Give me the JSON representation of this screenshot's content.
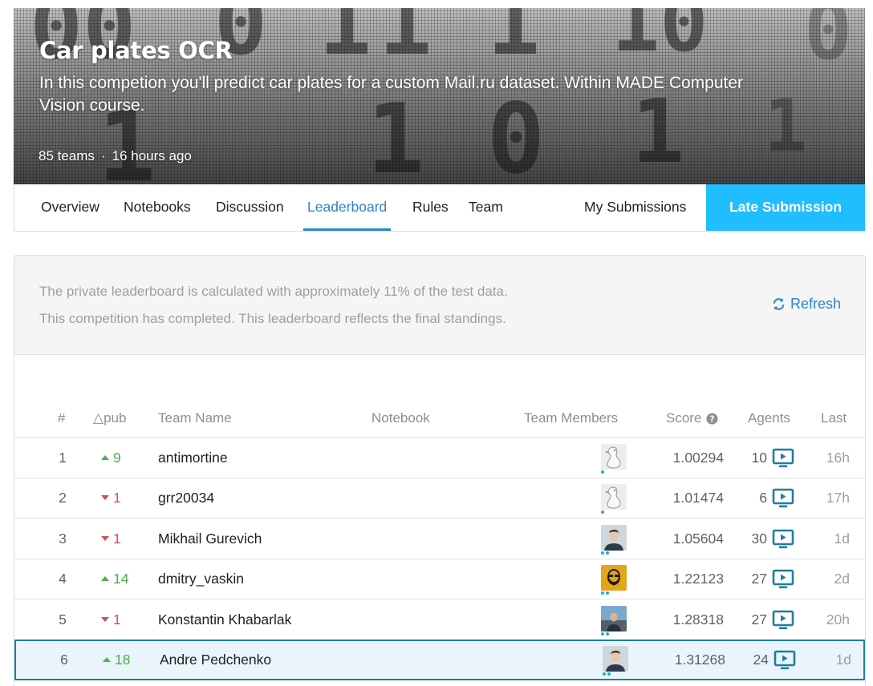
{
  "competition": {
    "title": "Car plates OCR",
    "subtitle": "In this competion you'll predict car plates for a custom Mail.ru dataset. Within MADE Computer Vision course.",
    "teams": "85 teams",
    "separator": "·",
    "updated": "16 hours ago"
  },
  "banner_digits": [
    "00",
    "0",
    "1",
    "1",
    "1",
    "10",
    "0",
    "1",
    "1",
    "0",
    "1",
    "1"
  ],
  "tabs": {
    "overview": "Overview",
    "notebooks": "Notebooks",
    "discussion": "Discussion",
    "leaderboard": "Leaderboard",
    "rules": "Rules",
    "team": "Team",
    "my_submissions": "My Submissions",
    "late_submission": "Late Submission"
  },
  "notice": {
    "line1": "The private leaderboard is calculated with approximately 11% of the test data.",
    "line2": "This competition has completed. This leaderboard reflects the final standings.",
    "refresh": "Refresh"
  },
  "columns": {
    "rank": "#",
    "delta": "△pub",
    "team_name": "Team Name",
    "notebook": "Notebook",
    "team_members": "Team Members",
    "score": "Score",
    "agents": "Agents",
    "last": "Last"
  },
  "rows": [
    {
      "rank": "1",
      "dir": "up",
      "delta": "9",
      "name": "antimortine",
      "avatar": "goose",
      "tiers": 1,
      "score": "1.00294",
      "agents": "10",
      "last": "16h"
    },
    {
      "rank": "2",
      "dir": "down",
      "delta": "1",
      "name": "grr20034",
      "avatar": "goose",
      "tiers": 1,
      "score": "1.01474",
      "agents": "6",
      "last": "17h"
    },
    {
      "rank": "3",
      "dir": "down",
      "delta": "1",
      "name": "Mikhail Gurevich",
      "avatar": "portrait",
      "tiers": 2,
      "score": "1.05604",
      "agents": "30",
      "last": "1d"
    },
    {
      "rank": "4",
      "dir": "up",
      "delta": "14",
      "name": "dmitry_vaskin",
      "avatar": "yellow-portrait",
      "tiers": 2,
      "score": "1.22123",
      "agents": "27",
      "last": "2d"
    },
    {
      "rank": "5",
      "dir": "down",
      "delta": "1",
      "name": "Konstantin Khabarlak",
      "avatar": "outdoor",
      "tiers": 2,
      "score": "1.28318",
      "agents": "27",
      "last": "20h"
    },
    {
      "rank": "6",
      "dir": "up",
      "delta": "18",
      "name": "Andre Pedchenko",
      "avatar": "portrait",
      "tiers": 2,
      "score": "1.31268",
      "agents": "24",
      "last": "1d",
      "highlight": true
    }
  ],
  "colors": {
    "accent": "#2a86c8",
    "late_button": "#20beff",
    "up": "#4caf50",
    "down": "#d05050",
    "highlight_bg": "#eaf4fb",
    "highlight_border": "#1f7ea1"
  }
}
